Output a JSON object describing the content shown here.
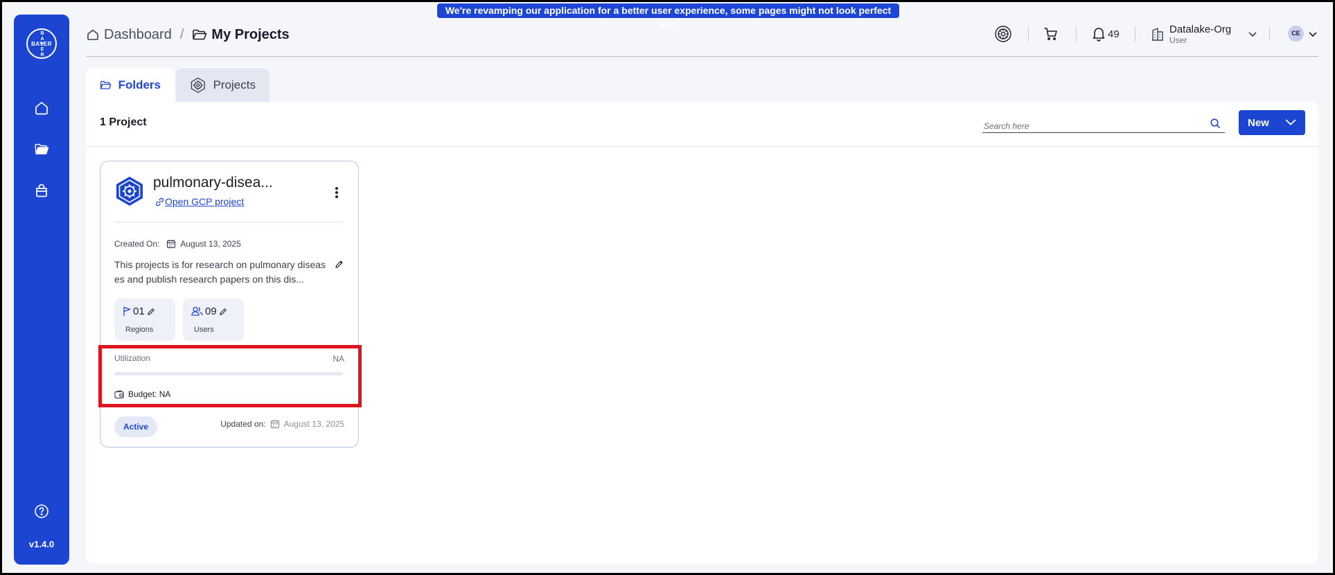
{
  "banner": {
    "text": "We're revamping our application for a better user experience, some pages might not look perfect yet!"
  },
  "sidebar": {
    "logo_text_h": "BAYER",
    "logo_text_v": "BAYER",
    "items": [
      {
        "icon": "home-icon"
      },
      {
        "icon": "folder-icon"
      },
      {
        "icon": "bag-icon"
      }
    ],
    "help_icon": "help-icon",
    "version": "v1.4.0"
  },
  "header": {
    "breadcrumb": {
      "dashboard": "Dashboard",
      "separator": "/",
      "current": "My Projects"
    },
    "notifications_count": "49",
    "org": {
      "name": "Datalake-Org",
      "role": "User"
    },
    "avatar_initials": "CE"
  },
  "tabs": [
    {
      "label": "Folders",
      "active": true
    },
    {
      "label": "Projects",
      "active": false
    }
  ],
  "toolbar": {
    "count": "1 Project",
    "search_placeholder": "Search here",
    "new_label": "New"
  },
  "project": {
    "title": "pulmonary-disea...",
    "link": "Open GCP project",
    "created_label": "Created On:",
    "created_date": "August 13, 2025",
    "description": "This projects is for research on pulmonary diseases and publish research papers on this dis...",
    "regions_count": "01",
    "regions_label": "Regions",
    "users_count": "09",
    "users_label": "Users",
    "utilization_label": "Utilization",
    "utilization_value": "NA",
    "utilization_fraction": 0,
    "budget": "Budget: NA",
    "status": "Active",
    "updated_label": "Updated on:",
    "updated_date": "August 13, 2025"
  },
  "colors": {
    "brand": "#1c45d1",
    "highlight": "#e0141c",
    "background": "#f5f6fa"
  }
}
